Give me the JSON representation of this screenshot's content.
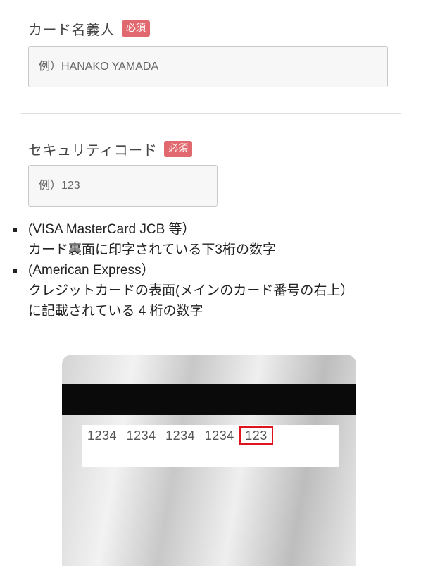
{
  "cardholder_name": {
    "label": "カード名義人",
    "required_badge": "必須",
    "placeholder": "例）HANAKO YAMADA"
  },
  "security_code": {
    "label": "セキュリティコード",
    "required_badge": "必須",
    "placeholder": "例）123"
  },
  "notes": [
    {
      "lines": [
        "(VISA MasterCard JCB 等）",
        "カード裏面に印字されている下3桁の数字"
      ]
    },
    {
      "lines": [
        "(American Express）",
        "クレジットカードの表面(メインのカード番号の右上）",
        "に記載されている 4 桁の数字"
      ]
    }
  ],
  "card_image": {
    "number_groups": [
      "1234",
      "1234",
      "1234",
      "1234"
    ],
    "security_code": "123",
    "highlight_color": "#e0141e"
  },
  "colors": {
    "required_badge": "#e0686e",
    "input_background": "#f7f7f7",
    "input_border": "#c9c9c9"
  }
}
